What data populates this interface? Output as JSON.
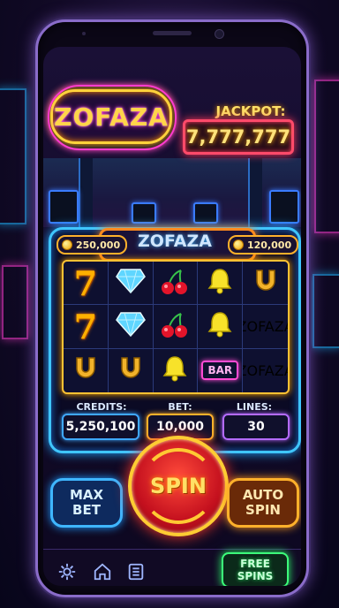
{
  "header": {
    "logo": "ZOFAZA",
    "jackpot_label": "JACKPOT:",
    "jackpot_value": "7,777,777"
  },
  "slot": {
    "title": "ZOFAZA",
    "left_coins": "250,000",
    "right_coins": "120,000",
    "reels": [
      [
        "seven",
        "diamond",
        "cherry",
        "bell",
        "horseshoe"
      ],
      [
        "seven",
        "diamond",
        "cherry",
        "bell",
        "zofaza"
      ],
      [
        "horseshoe",
        "horseshoe",
        "bell",
        "bar",
        "zofaza"
      ]
    ],
    "symbol_text": {
      "seven": "7",
      "bar": "BAR",
      "zofaza": "ZOFAZA"
    }
  },
  "stats": {
    "credits_label": "CREDITS:",
    "credits_value": "5,250,100",
    "bet_label": "BET:",
    "bet_value": "10,000",
    "lines_label": "LINES:",
    "lines_value": "30"
  },
  "controls": {
    "max_bet": "MAX BET",
    "spin": "SPIN",
    "auto_spin": "AUTO SPIN",
    "free_spins": "FREE SPINS"
  },
  "icons": [
    "gear-icon",
    "home-icon",
    "menu-list-icon"
  ],
  "colors": {
    "neon_blue": "#3fc6ff",
    "neon_gold": "#ffc233",
    "neon_pink": "#ff3cd0",
    "spin_red": "#c4101e",
    "free_green": "#3cff7a"
  }
}
